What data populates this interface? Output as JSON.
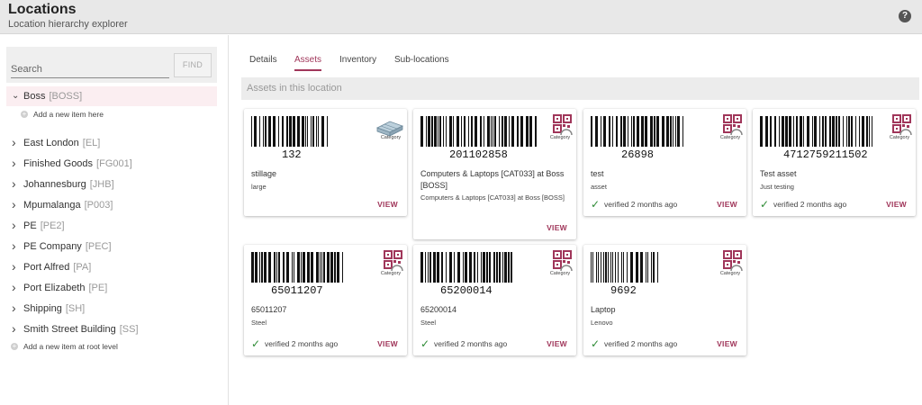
{
  "header": {
    "title": "Locations",
    "subtitle": "Location hierarchy explorer",
    "help_glyph": "?"
  },
  "sidebar": {
    "search_placeholder": "Search",
    "find_label": "FIND",
    "selected": {
      "name": "Boss",
      "code": "[BOSS]",
      "chevron": "⌄"
    },
    "add_child_label": "Add a new item here",
    "items": [
      {
        "name": "East London",
        "code": "[EL]"
      },
      {
        "name": "Finished Goods",
        "code": "[FG001]"
      },
      {
        "name": "Johannesburg",
        "code": "[JHB]"
      },
      {
        "name": "Mpumalanga",
        "code": "[P003]"
      },
      {
        "name": "PE",
        "code": "[PE2]"
      },
      {
        "name": "PE Company",
        "code": "[PEC]"
      },
      {
        "name": "Port Alfred",
        "code": "[PA]"
      },
      {
        "name": "Port Elizabeth",
        "code": "[PE]"
      },
      {
        "name": "Shipping",
        "code": "[SH]"
      },
      {
        "name": "Smith Street Building",
        "code": "[SS]"
      }
    ],
    "add_root_label": "Add a new item at root level"
  },
  "tabs": [
    {
      "label": "Details",
      "active": false
    },
    {
      "label": "Assets",
      "active": true
    },
    {
      "label": "Inventory",
      "active": false
    },
    {
      "label": "Sub-locations",
      "active": false
    }
  ],
  "section_title": "Assets in this location",
  "colors": {
    "accent": "#a0365a",
    "verified": "#2e8b36"
  },
  "assets": [
    {
      "barcode": "132",
      "category": "Category",
      "icon": "pallet-icon",
      "title": "stillage",
      "subtitle": "large",
      "verified": "",
      "view": "VIEW"
    },
    {
      "barcode": "201102858",
      "category": "Category",
      "icon": "qr-category-icon",
      "title": "Computers & Laptops [CAT033] at Boss [BOSS]",
      "subtitle": "Computers & Laptops [CAT033] at Boss [BOSS]",
      "verified": "",
      "view": "VIEW"
    },
    {
      "barcode": "26898",
      "category": "Category",
      "icon": "qr-category-icon",
      "title": "test",
      "subtitle": "asset",
      "verified": "verified 2 months ago",
      "view": "VIEW"
    },
    {
      "barcode": "4712759211502",
      "category": "Category",
      "icon": "qr-category-icon",
      "title": "Test asset",
      "subtitle": "Just testing",
      "verified": "verified 2 months ago",
      "view": "VIEW"
    },
    {
      "barcode": "65011207",
      "category": "Category",
      "icon": "qr-category-icon",
      "title": "65011207",
      "subtitle": "Steel",
      "verified": "verified 2 months ago",
      "view": "VIEW"
    },
    {
      "barcode": "65200014",
      "category": "Category",
      "icon": "qr-category-icon",
      "title": "65200014",
      "subtitle": "Steel",
      "verified": "verified 2 months ago",
      "view": "VIEW"
    },
    {
      "barcode": "9692",
      "category": "Category",
      "icon": "qr-category-icon",
      "title": "Laptop",
      "subtitle": "Lenovo",
      "verified": "verified 2 months ago",
      "view": "VIEW"
    }
  ]
}
